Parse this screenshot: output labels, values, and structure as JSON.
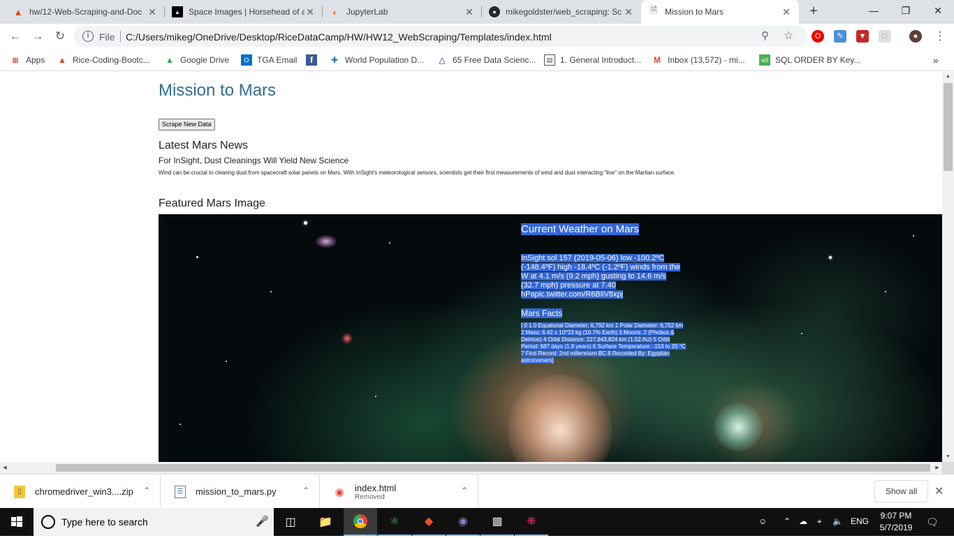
{
  "browser": {
    "tabs": [
      {
        "title": "hw/12-Web-Scraping-and-Doc",
        "icon": "gitlab-icon",
        "color": "#e24329"
      },
      {
        "title": "Space Images | Horsehead of a",
        "icon": "jpl-icon",
        "color": "#000000"
      },
      {
        "title": "JupyterLab",
        "icon": "jupyter-icon",
        "color": "#f37726"
      },
      {
        "title": "mikegoldster/web_scraping: Sc",
        "icon": "github-icon",
        "color": "#24292e"
      },
      {
        "title": "Mission to Mars",
        "icon": "page-icon",
        "color": "#5f6368",
        "active": true
      }
    ],
    "address": {
      "scheme": "File",
      "url": "C:/Users/mikeg/OneDrive/Desktop/RiceDataCamp/HW/HW12_WebScraping/Templates/index.html"
    },
    "bookmarks": [
      {
        "label": "Apps",
        "icon": "apps-grid-icon"
      },
      {
        "label": "Rice-Coding-Bootc...",
        "icon": "gitlab-icon"
      },
      {
        "label": "Google Drive",
        "icon": "google-drive-icon"
      },
      {
        "label": "TGA Email",
        "icon": "outlook-icon"
      },
      {
        "label": "",
        "icon": "facebook-icon"
      },
      {
        "label": "World Population D...",
        "icon": "tableau-icon"
      },
      {
        "label": "65 Free Data Scienc...",
        "icon": "flask-icon"
      },
      {
        "label": "1. General Introduct...",
        "icon": "doc-icon"
      },
      {
        "label": "Inbox (13,572) - mi...",
        "icon": "gmail-icon"
      },
      {
        "label": "SQL ORDER BY Key...",
        "icon": "w3schools-icon"
      }
    ]
  },
  "page": {
    "title": "Mission to Mars",
    "scrape_button": "Scrape New Data",
    "news_heading": "Latest Mars News",
    "news_title": "For InSight, Dust Cleanings Will Yield New Science",
    "news_paragraph": "Wind can be crucial to clearing dust from spacecraft solar panels on Mars. With InSight's meteorological sensors, scientists get their first measurements of wind and dust interacting \"live\" on the Martian surface.",
    "image_heading": "Featured Mars Image",
    "weather_heading": "Current Weather on Mars",
    "weather_text": "InSight sol 157 (2019-05-06) low -100.2ºC (-148.4ºF) high -18.4ºC (-1.2ºF) winds from the W at 4.1 m/s (9.2 mph) gusting to 14.6 m/s (32.7 mph) pressure at 7.40 hPapic.twitter.com/R6BliV8xpj",
    "facts_heading": "Mars Facts",
    "facts_text": "[ 0 1 0 Equatorial Diameter: 6,792 km 1 Polar Diameter: 6,752 km 2 Mass: 6.42 x 10^23 kg (10.7% Earth) 3 Moons: 2 (Phobos & Deimos) 4 Orbit Distance: 227,943,824 km (1.52 AU) 5 Orbit Period: 687 days (1.9 years) 6 Surface Temperature: -153 to 20 °C 7 First Record: 2nd millennium BC 8 Recorded By: Egyptian astronomers]"
  },
  "downloads": [
    {
      "name": "chromedriver_win3....zip",
      "sub": "",
      "icon": "zip-icon"
    },
    {
      "name": "mission_to_mars.py",
      "sub": "",
      "icon": "python-file-icon"
    },
    {
      "name": "index.html",
      "sub": "Removed",
      "icon": "chrome-icon"
    }
  ],
  "downloads_show_all": "Show all",
  "taskbar": {
    "search_placeholder": "Type here to search",
    "language": "ENG",
    "time": "9:07 PM",
    "date": "5/7/2019"
  },
  "colors": {
    "title_blue": "#336e8f",
    "selection": "#3367d6"
  }
}
